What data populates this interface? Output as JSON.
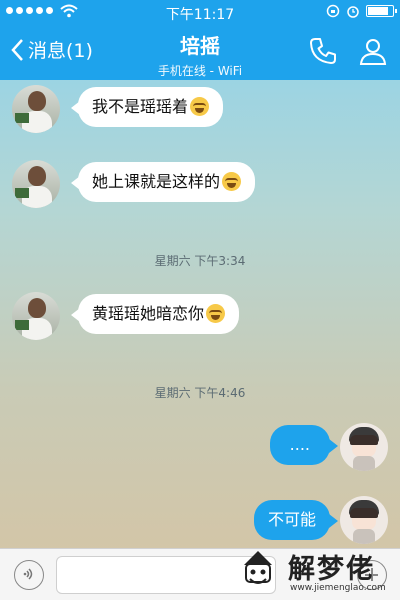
{
  "status_bar": {
    "time": "下午11:17",
    "signal_icon": "signal-dots-icon",
    "wifi_icon": "wifi-icon",
    "battery_level": 0.9
  },
  "nav": {
    "back_label": "消息(1)",
    "title": "培摇",
    "subtitle": "手机在线 - WiFi",
    "phone_icon": "phone-icon",
    "profile_icon": "profile-icon"
  },
  "messages": [
    {
      "direction": "in",
      "text": "我不是瑶瑶着",
      "emoji": "laughing-crying-emoji"
    },
    {
      "direction": "in",
      "text": "她上课就是这样的",
      "emoji": "laughing-crying-emoji"
    },
    {
      "type": "timestamp",
      "text": "星期六 下午3:34"
    },
    {
      "direction": "in",
      "text": "黄瑶瑶她暗恋你",
      "emoji": "laughing-crying-emoji"
    },
    {
      "type": "timestamp",
      "text": "星期六 下午4:46"
    },
    {
      "direction": "out",
      "text": "...."
    },
    {
      "direction": "out",
      "text": "不可能"
    }
  ],
  "colors": {
    "accent": "#1ea3ec",
    "bubble_in": "#ffffff",
    "bubble_out": "#1ea3ec"
  },
  "watermark": {
    "text": "解梦佬",
    "url": "www.jiemenglao.com"
  }
}
